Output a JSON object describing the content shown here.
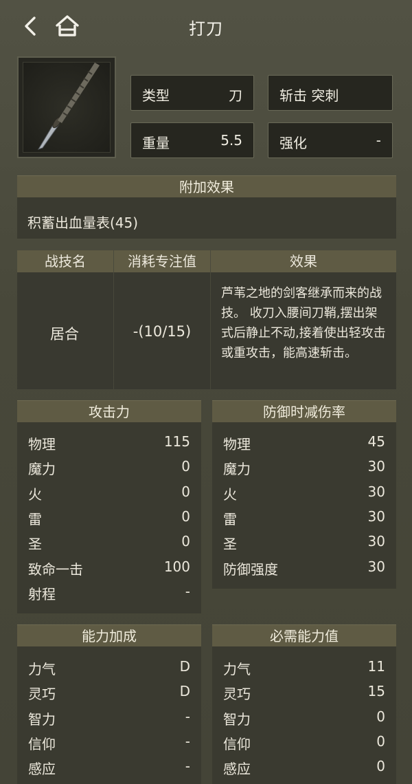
{
  "header": {
    "title": "打刀"
  },
  "weapon": {
    "type_label": "类型",
    "type_value": "刀",
    "damage_type": "斩击 突刺",
    "weight_label": "重量",
    "weight_value": "5.5",
    "upgrade_label": "强化",
    "upgrade_value": "-"
  },
  "affix": {
    "title": "附加效果",
    "text": "积蓄出血量表(45)"
  },
  "skill": {
    "col_name": "战技名",
    "col_cost": "消耗专注值",
    "col_effect": "效果",
    "name": "居合",
    "cost": "-(10/15)",
    "effect": "芦苇之地的剑客继承而来的战技。 收刀入腰间刀鞘,摆出架式后静止不动,接着使出轻攻击或重攻击，能高速斩击。"
  },
  "attack": {
    "title": "攻击力",
    "rows": [
      {
        "k": "物理",
        "v": "115"
      },
      {
        "k": "魔力",
        "v": "0"
      },
      {
        "k": "火",
        "v": "0"
      },
      {
        "k": "雷",
        "v": "0"
      },
      {
        "k": "圣",
        "v": "0"
      },
      {
        "k": "致命一击",
        "v": "100"
      },
      {
        "k": "射程",
        "v": "-"
      }
    ]
  },
  "guard": {
    "title": "防御时减伤率",
    "rows": [
      {
        "k": "物理",
        "v": "45"
      },
      {
        "k": "魔力",
        "v": "30"
      },
      {
        "k": "火",
        "v": "30"
      },
      {
        "k": "雷",
        "v": "30"
      },
      {
        "k": "圣",
        "v": "30"
      },
      {
        "k": "防御强度",
        "v": "30"
      }
    ]
  },
  "scaling": {
    "title": "能力加成",
    "rows": [
      {
        "k": "力气",
        "v": "D"
      },
      {
        "k": "灵巧",
        "v": "D"
      },
      {
        "k": "智力",
        "v": "-"
      },
      {
        "k": "信仰",
        "v": "-"
      },
      {
        "k": "感应",
        "v": "-"
      }
    ]
  },
  "requirements": {
    "title": "必需能力值",
    "rows": [
      {
        "k": "力气",
        "v": "11"
      },
      {
        "k": "灵巧",
        "v": "15"
      },
      {
        "k": "智力",
        "v": "0"
      },
      {
        "k": "信仰",
        "v": "0"
      },
      {
        "k": "感应",
        "v": "0"
      }
    ]
  }
}
